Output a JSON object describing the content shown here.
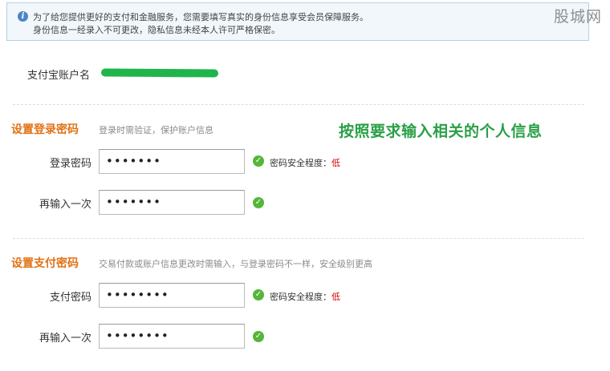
{
  "notice": {
    "line1": "为了给您提供更好的支付和金融服务，您需要填写真实的身份信息享受会员保障服务。",
    "line2": "身份信息一经录入不可更改，隐私信息未经本人许可严格保密。",
    "icon": "info-icon"
  },
  "watermark": "股城网",
  "account": {
    "label": "支付宝账户名"
  },
  "callout": "按照要求输入相关的个人信息",
  "login_section": {
    "title": "设置登录密码",
    "description": "登录时需验证，保护账户信息",
    "password_label": "登录密码",
    "password_value": "•••••••",
    "confirm_label": "再输入一次",
    "confirm_value": "•••••••",
    "strength_label": "密码安全程度：",
    "strength_level": "低"
  },
  "pay_section": {
    "title": "设置支付密码",
    "description": "交易付款或账户信息更改时需输入，与登录密码不一样，安全级别更高",
    "password_label": "支付密码",
    "password_value": "••••••••",
    "confirm_label": "再输入一次",
    "confirm_value": "••••••••",
    "strength_label": "密码安全程度：",
    "strength_level": "低"
  },
  "colors": {
    "section_title": "#e07214",
    "callout": "#2aa046",
    "check": "#55b63a",
    "strength_low": "#d40000",
    "notice_bg": "#f1f7fb"
  }
}
